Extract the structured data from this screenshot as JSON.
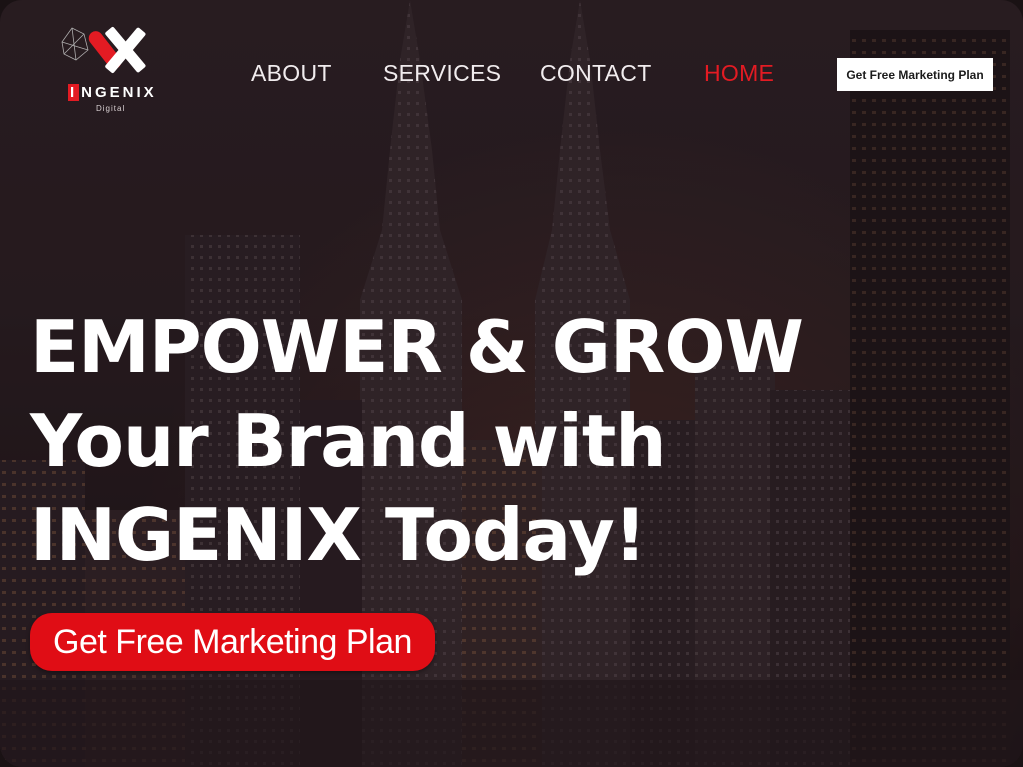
{
  "brand": {
    "logo_first_letter": "I",
    "logo_rest": "NGENIX",
    "logo_sub": "Digital",
    "accent_color": "#e31b23"
  },
  "nav": {
    "items": [
      {
        "label": "ABOUT",
        "active": false
      },
      {
        "label": "SERVICES",
        "active": false
      },
      {
        "label": "CONTACT",
        "active": false
      },
      {
        "label": "HOME",
        "active": true
      }
    ],
    "cta_label": "Get Free Marketing Plan"
  },
  "hero": {
    "headline_lines": [
      "EMPOWER & GROW",
      "Your Brand with",
      "INGENIX Today!"
    ],
    "cta_label": "Get Free Marketing Plan"
  }
}
